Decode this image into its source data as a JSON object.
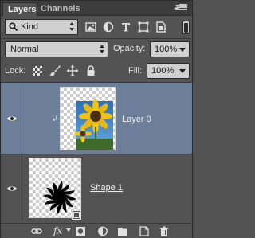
{
  "tabs": [
    {
      "label": "Layers",
      "active": true
    },
    {
      "label": "Channels",
      "active": false
    }
  ],
  "filter": {
    "kind_label": "Kind",
    "filter_icons": [
      "image-filter-icon",
      "adjustment-filter-icon",
      "type-filter-icon",
      "shape-filter-icon",
      "smart-object-filter-icon"
    ]
  },
  "blend": {
    "mode": "Normal",
    "opacity_label": "Opacity:",
    "opacity_value": "100%"
  },
  "lock": {
    "label": "Lock:",
    "lock_icons": [
      "lock-transparency-icon",
      "lock-pixels-icon",
      "lock-position-icon",
      "lock-all-icon"
    ],
    "fill_label": "Fill:",
    "fill_value": "100%"
  },
  "layers": [
    {
      "name": "Layer 0",
      "selected": true,
      "visible": true,
      "type": "pixel"
    },
    {
      "name": "Shape 1",
      "selected": false,
      "visible": true,
      "type": "shape"
    }
  ],
  "footer_icons": [
    "link-layers-icon",
    "fx-icon",
    "add-mask-icon",
    "adjustment-layer-icon",
    "new-group-icon",
    "new-layer-icon",
    "delete-layer-icon"
  ],
  "footer": {
    "fx_label": "fx"
  },
  "colors": {
    "panel_bg": "#535353",
    "selected_row": "#6c7e98",
    "field_bg": "#cfcfcf",
    "border": "#2a2a2a"
  }
}
